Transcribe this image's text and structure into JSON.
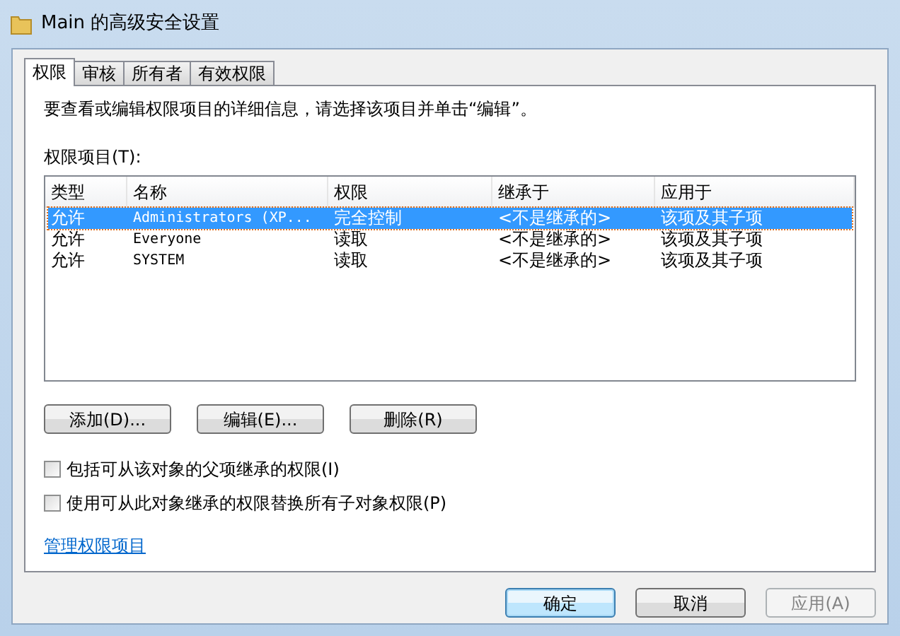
{
  "window": {
    "title": "Main 的高级安全设置"
  },
  "tabs": [
    {
      "label": "权限",
      "selected": true
    },
    {
      "label": "审核",
      "selected": false
    },
    {
      "label": "所有者",
      "selected": false
    },
    {
      "label": "有效权限",
      "selected": false
    }
  ],
  "description": "要查看或编辑权限项目的详细信息，请选择该项目并单击“编辑”。",
  "list_label": "权限项目(T):",
  "table": {
    "columns": [
      "类型",
      "名称",
      "权限",
      "继承于",
      "应用于"
    ],
    "rows": [
      {
        "cells": [
          "允许",
          "Administrators (XP...",
          "完全控制",
          "<不是继承的>",
          "该项及其子项"
        ],
        "selected": true
      },
      {
        "cells": [
          "允许",
          "Everyone",
          "读取",
          "<不是继承的>",
          "该项及其子项"
        ],
        "selected": false
      },
      {
        "cells": [
          "允许",
          "SYSTEM",
          "读取",
          "<不是继承的>",
          "该项及其子项"
        ],
        "selected": false
      }
    ]
  },
  "list_buttons": [
    "添加(D)...",
    "编辑(E)...",
    "删除(R)"
  ],
  "checkboxes": [
    {
      "label": "包括可从该对象的父项继承的权限(I)",
      "checked": false
    },
    {
      "label": "使用可从此对象继承的权限替换所有子对象权限(P)",
      "checked": false
    }
  ],
  "link": "管理权限项目",
  "buttons": [
    {
      "label": "确定",
      "default": true,
      "disabled": false
    },
    {
      "label": "取消",
      "default": false,
      "disabled": false
    },
    {
      "label": "应用(A)",
      "default": false,
      "disabled": true
    }
  ]
}
